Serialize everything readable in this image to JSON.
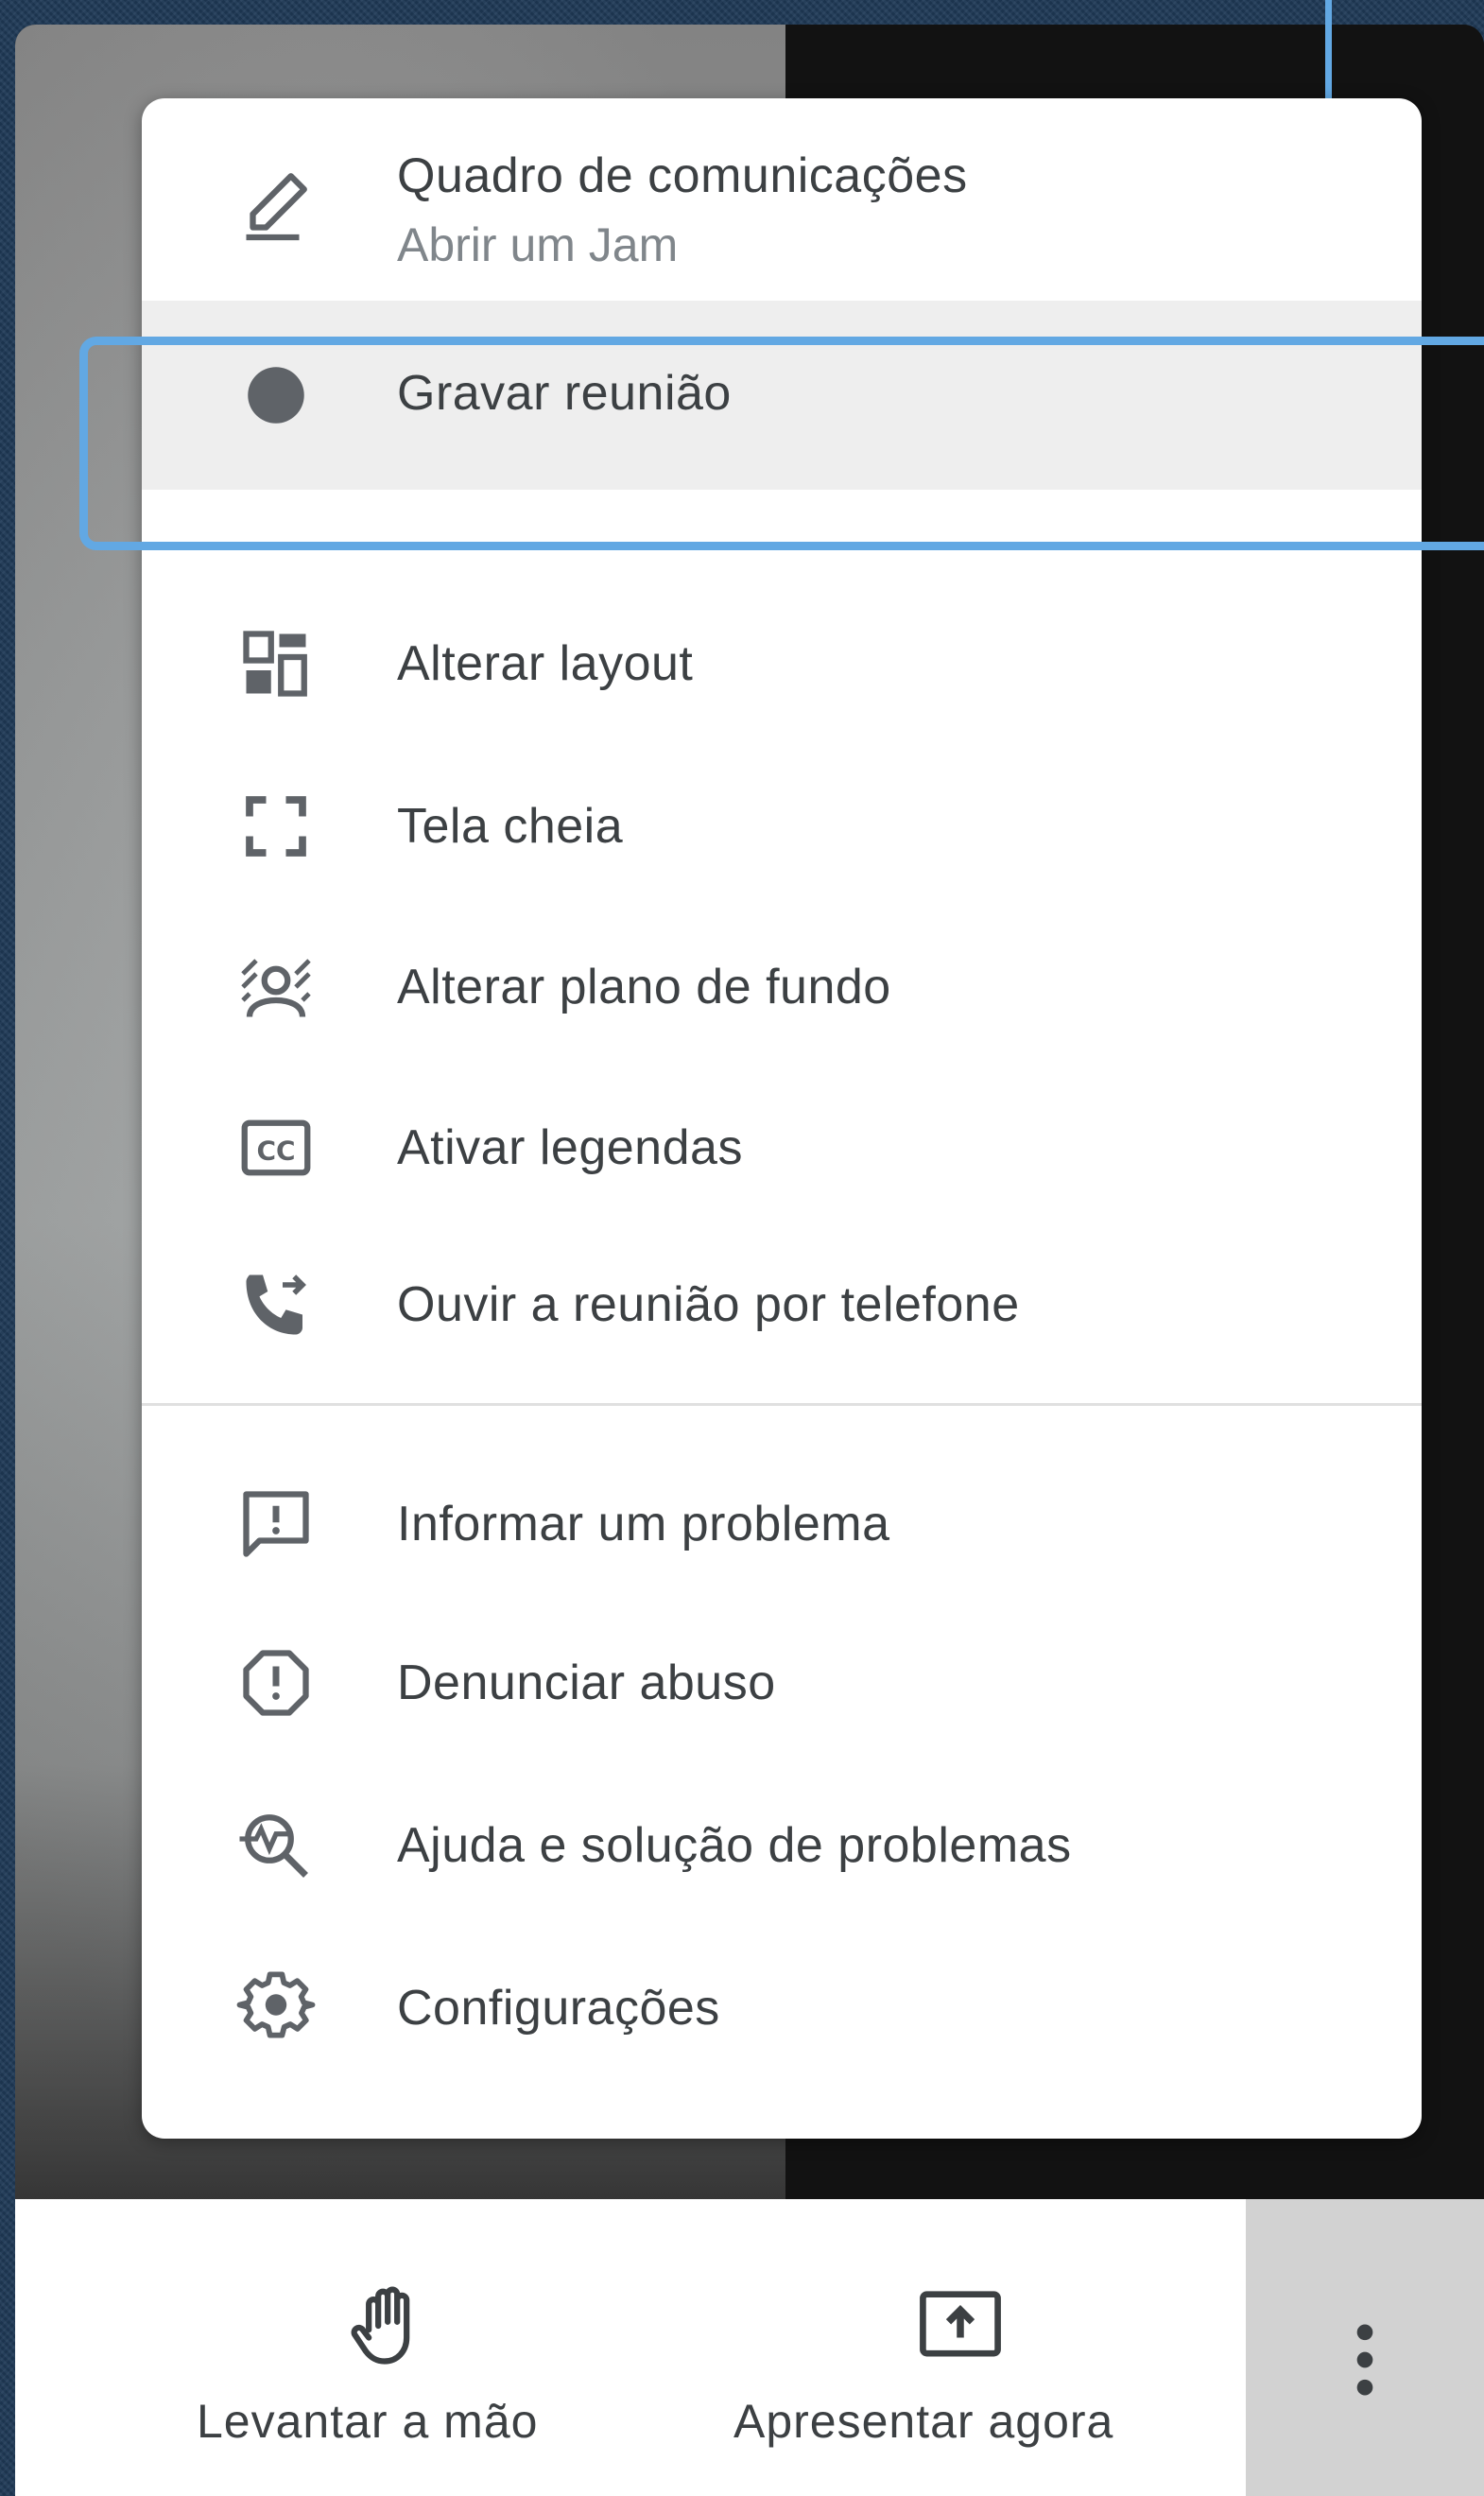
{
  "menu": {
    "items": [
      {
        "label": "Quadro de comunicações",
        "sublabel": "Abrir um Jam",
        "icon": "pencil-icon"
      },
      {
        "label": "Gravar reunião",
        "icon": "record-dot-icon",
        "highlighted": true
      },
      {
        "label": "Alterar layout",
        "icon": "layout-icon"
      },
      {
        "label": "Tela cheia",
        "icon": "fullscreen-icon"
      },
      {
        "label": "Alterar plano de fundo",
        "icon": "background-icon"
      },
      {
        "label": "Ativar legendas",
        "icon": "closed-captions-icon"
      },
      {
        "label": "Ouvir a reunião por telefone",
        "icon": "phone-forward-icon"
      },
      {
        "label": "Informar um problema",
        "icon": "feedback-icon"
      },
      {
        "label": "Denunciar abuso",
        "icon": "report-icon"
      },
      {
        "label": "Ajuda e solução de problemas",
        "icon": "troubleshoot-icon"
      },
      {
        "label": "Configurações",
        "icon": "gear-icon"
      }
    ]
  },
  "bottom_bar": {
    "raise_hand_label": "Levantar a mão",
    "present_label": "Apresentar agora",
    "more_icon": "more-vert-icon"
  },
  "colors": {
    "highlight_outline": "#62a8e3",
    "icon": "#5f6368",
    "text": "#3c4043",
    "subtext": "#80868b",
    "selected_row": "#eeeeee"
  }
}
